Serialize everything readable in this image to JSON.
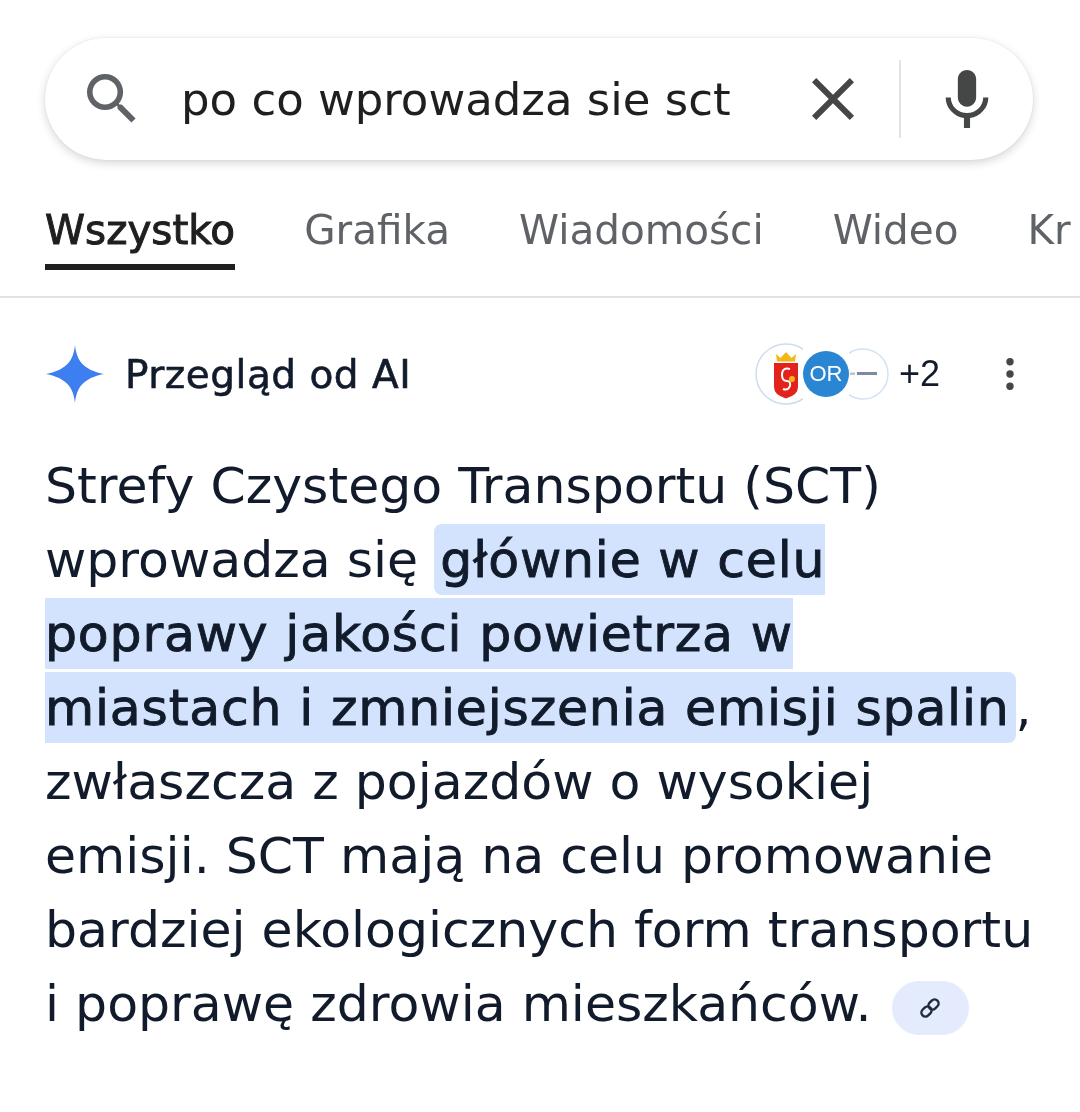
{
  "search": {
    "query": "po co wprowadza sie sct"
  },
  "tabs": [
    {
      "label": "Wszystko",
      "selected": true
    },
    {
      "label": "Grafika",
      "selected": false
    },
    {
      "label": "Wiadomości",
      "selected": false
    },
    {
      "label": "Wideo",
      "selected": false
    },
    {
      "label": "Kr",
      "selected": false
    }
  ],
  "ai_overview": {
    "title": "Przegląd od AI",
    "sources": [
      {
        "kind": "crest"
      },
      {
        "kind": "monogram",
        "label": "OR"
      },
      {
        "kind": "wordmark"
      }
    ],
    "more_sources": "+2",
    "answer": "Strefy Czystego Transportu (SCT) wprowadza się **głównie w celu poprawy jakości powietrza w miastach i zmniejszenia emisji spalin**, zwłaszcza z pojazdów o wysokiej emisji. SCT mają na celu promowanie bardziej ekologicznych form transportu i poprawę zdrowia mieszkańców."
  }
}
